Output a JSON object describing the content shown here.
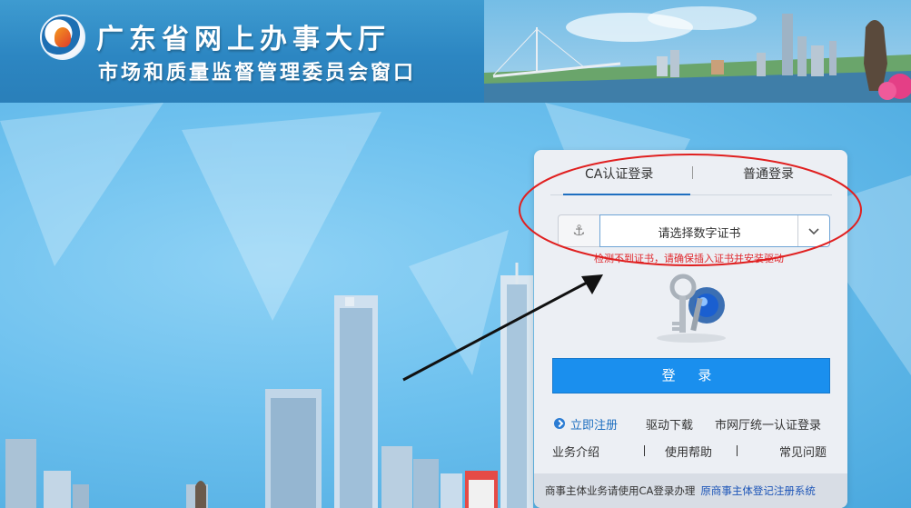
{
  "header": {
    "title_line1": "广东省网上办事大厅",
    "title_line2": "市场和质量监督管理委员会窗口"
  },
  "login": {
    "tabs": [
      {
        "label": "CA认证登录",
        "active": true
      },
      {
        "label": "普通登录",
        "active": false
      }
    ],
    "cert_select": {
      "placeholder": "请选择数字证书",
      "icon": "anchor-icon"
    },
    "warning": "检测不到证书，请确保插入证书并安装驱动",
    "login_button": "登 录",
    "links_row1": {
      "register": "立即注册",
      "driver_download": "驱动下载",
      "unified_login": "市网厅统一认证登录"
    },
    "links_row2": {
      "business_intro": "业务介绍",
      "help": "使用帮助",
      "faq": "常见问题"
    },
    "footer": {
      "text": "商事主体业务请使用CA登录办理",
      "link": "原商事主体登记注册系统"
    }
  },
  "colors": {
    "header_blue": "#2c86c2",
    "login_button": "#1a8fee",
    "warning_red": "#e0262b",
    "annotation_red": "#e02020",
    "link_blue": "#1e6fc0"
  }
}
